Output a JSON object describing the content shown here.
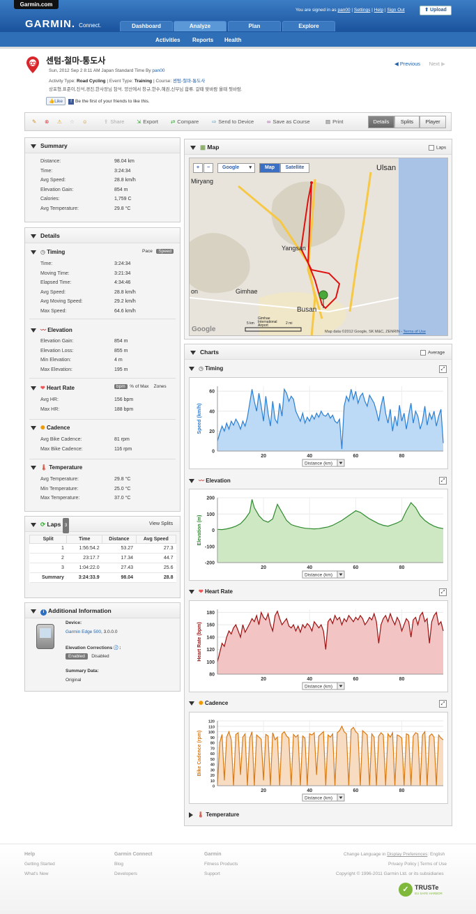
{
  "header": {
    "site": "Garmin.com",
    "logo": "GARMIN.",
    "logo_sub": "Connect.",
    "signed_in_prefix": "You are signed in as",
    "username": "pan00",
    "links": [
      "Settings",
      "Help",
      "Sign Out"
    ],
    "upload": "Upload",
    "tabs": [
      "Dashboard",
      "Analyze",
      "Plan",
      "Explore"
    ],
    "subnav": [
      "Activities",
      "Reports",
      "Health"
    ]
  },
  "activity": {
    "title": "센텀-철마-통도사",
    "date_line": "Sun, 2012 Sep 2 8:11 AM Japan Standard Time By",
    "author": "pan00",
    "type_label": "Activity Type:",
    "type": "Road Cycling",
    "event_label": "| Event Type:",
    "event": "Training",
    "course_label": "| Course:",
    "course": "센텀-철마-통도사",
    "description": "상포형,표준이,진석,경진,한사장님 참석. 양산에서 창규,한수,혜권,신부님 합류. 갈때 맞바람 올때 뒷바람.",
    "previous": "Previous",
    "next": "Next",
    "like": "Like",
    "like_text": "Be the first of your friends to like this."
  },
  "toolbar": {
    "items": [
      "Share",
      "Export",
      "Compare",
      "Send to Device",
      "Save as Course",
      "Print"
    ],
    "views": [
      "Details",
      "Splits",
      "Player"
    ]
  },
  "summary": {
    "title": "Summary",
    "rows": [
      {
        "label": "Distance:",
        "value": "98.04 km"
      },
      {
        "label": "Time:",
        "value": "3:24:34"
      },
      {
        "label": "Avg Speed:",
        "value": "28.8 km/h"
      },
      {
        "label": "Elevation Gain:",
        "value": "854 m"
      },
      {
        "label": "Calories:",
        "value": "1,759 C"
      },
      {
        "label": "Avg Temperature:",
        "value": "29.8 °C"
      }
    ]
  },
  "details": {
    "title": "Details",
    "timing": {
      "title": "Timing",
      "pace": "Pace",
      "speed": "Speed",
      "rows": [
        {
          "label": "Time:",
          "value": "3:24:34"
        },
        {
          "label": "Moving Time:",
          "value": "3:21:34"
        },
        {
          "label": "Elapsed Time:",
          "value": "4:34:46"
        },
        {
          "label": "Avg Speed:",
          "value": "28.8 km/h"
        },
        {
          "label": "Avg Moving Speed:",
          "value": "29.2 km/h"
        },
        {
          "label": "Max Speed:",
          "value": "64.6 km/h"
        }
      ]
    },
    "elevation": {
      "title": "Elevation",
      "rows": [
        {
          "label": "Elevation Gain:",
          "value": "854 m"
        },
        {
          "label": "Elevation Loss:",
          "value": "855 m"
        },
        {
          "label": "Min Elevation:",
          "value": "4 m"
        },
        {
          "label": "Max Elevation:",
          "value": "195 m"
        }
      ]
    },
    "heart": {
      "title": "Heart Rate",
      "bpm": "bpm",
      "pct": "% of Max",
      "zones": "Zones",
      "rows": [
        {
          "label": "Avg HR:",
          "value": "156 bpm"
        },
        {
          "label": "Max HR:",
          "value": "188 bpm"
        }
      ]
    },
    "cadence": {
      "title": "Cadence",
      "rows": [
        {
          "label": "Avg Bike Cadence:",
          "value": "81 rpm"
        },
        {
          "label": "Max Bike Cadence:",
          "value": "116 rpm"
        }
      ]
    },
    "temperature": {
      "title": "Temperature",
      "rows": [
        {
          "label": "Avg Temperature:",
          "value": "29.8 °C"
        },
        {
          "label": "Min Temperature:",
          "value": "25.0 °C"
        },
        {
          "label": "Max Temperature:",
          "value": "37.0 °C"
        }
      ]
    }
  },
  "laps": {
    "title": "Laps",
    "count": "3",
    "view_splits": "View Splits",
    "columns": [
      "Split",
      "Time",
      "Distance",
      "Avg Speed"
    ],
    "rows": [
      [
        "1",
        "1:56:54.2",
        "53.27",
        "27.3"
      ],
      [
        "2",
        "23:17.7",
        "17.34",
        "44.7"
      ],
      [
        "3",
        "1:04:22.0",
        "27.43",
        "25.6"
      ],
      [
        "Summary",
        "3:24:33.9",
        "98.04",
        "28.8"
      ]
    ]
  },
  "additional": {
    "title": "Additional Information",
    "device_label": "Device:",
    "device": "Garmin Edge 500",
    "device_version": ", 3.0.0.0",
    "corrections_label": "Elevation Corrections",
    "enabled": "Enabled",
    "disabled": "Disabled",
    "summary_label": "Summary Data:",
    "summary_value": "Original"
  },
  "map": {
    "title": "Map",
    "laps": "Laps",
    "provider": "Google",
    "map": "Map",
    "satellite": "Satellite",
    "labels": [
      "Ulsan",
      "Miryang",
      "Yangsan",
      "Gimhae",
      "Busan",
      "on",
      "Gimhae International Airport"
    ],
    "attribution": "Map data ©2012 Google, SK M&C, ZENRIN -",
    "terms": "Terms of Use",
    "google": "Google",
    "scale_km": "5 km",
    "scale_mi": "2 mi"
  },
  "charts": {
    "title": "Charts",
    "average": "Average",
    "xaxis": "Distance (km)",
    "temperature_title": "Temperature"
  },
  "chart_data": [
    {
      "type": "area",
      "title": "Timing",
      "ylabel": "Speed (km/h)",
      "xlabel": "Distance (km)",
      "ylim": [
        0,
        65
      ],
      "xlim": [
        0,
        98
      ],
      "yticks": [
        0,
        20,
        40,
        60
      ],
      "xticks": [
        20,
        40,
        60,
        80
      ],
      "color": "#2a7fd4",
      "fill": "#bcd9f5",
      "x": [
        0,
        1,
        2,
        3,
        4,
        5,
        6,
        7,
        8,
        9,
        10,
        11,
        12,
        13,
        14,
        15,
        16,
        17,
        18,
        19,
        20,
        21,
        22,
        23,
        24,
        25,
        26,
        27,
        28,
        29,
        30,
        31,
        32,
        33,
        34,
        35,
        36,
        37,
        38,
        39,
        40,
        41,
        42,
        43,
        44,
        45,
        46,
        47,
        48,
        49,
        50,
        51,
        52,
        53,
        54,
        55,
        56,
        57,
        58,
        59,
        60,
        61,
        62,
        63,
        64,
        65,
        66,
        67,
        68,
        69,
        70,
        71,
        72,
        73,
        74,
        75,
        76,
        77,
        78,
        79,
        80,
        81,
        82,
        83,
        84,
        85,
        86,
        87,
        88,
        89,
        90,
        91,
        92,
        93,
        94,
        95,
        96,
        97,
        98
      ],
      "y": [
        10,
        18,
        25,
        20,
        28,
        22,
        30,
        26,
        32,
        28,
        22,
        30,
        25,
        34,
        48,
        62,
        50,
        40,
        58,
        45,
        30,
        55,
        38,
        25,
        50,
        32,
        28,
        48,
        35,
        62,
        58,
        50,
        55,
        52,
        40,
        35,
        30,
        38,
        28,
        34,
        30,
        36,
        32,
        38,
        34,
        40,
        36,
        35,
        38,
        33,
        36,
        30,
        28,
        32,
        2,
        45,
        55,
        50,
        62,
        52,
        60,
        48,
        55,
        58,
        50,
        45,
        56,
        52,
        48,
        40,
        30,
        45,
        55,
        38,
        28,
        42,
        20,
        35,
        25,
        46,
        30,
        38,
        22,
        36,
        48,
        28,
        40,
        35,
        22,
        30,
        45,
        26,
        38,
        32,
        40,
        25,
        35,
        42,
        8
      ]
    },
    {
      "type": "area",
      "title": "Elevation",
      "ylabel": "Elevation (m)",
      "xlabel": "Distance (km)",
      "ylim": [
        -200,
        200
      ],
      "xlim": [
        0,
        98
      ],
      "yticks": [
        -200,
        -100,
        0,
        100,
        200
      ],
      "xticks": [
        20,
        40,
        60,
        80
      ],
      "color": "#2e8a2e",
      "fill": "#cfe8c4",
      "x": [
        0,
        2,
        4,
        6,
        8,
        10,
        12,
        14,
        15,
        16,
        18,
        20,
        22,
        24,
        26,
        28,
        30,
        32,
        34,
        36,
        38,
        40,
        42,
        44,
        46,
        48,
        50,
        52,
        54,
        56,
        58,
        60,
        62,
        64,
        66,
        68,
        70,
        72,
        74,
        76,
        78,
        80,
        82,
        84,
        86,
        88,
        90,
        92,
        94,
        96,
        98
      ],
      "y": [
        5,
        4,
        8,
        15,
        25,
        40,
        70,
        110,
        190,
        140,
        90,
        60,
        50,
        70,
        160,
        110,
        60,
        35,
        25,
        18,
        12,
        10,
        8,
        10,
        15,
        20,
        30,
        45,
        60,
        80,
        100,
        120,
        110,
        90,
        70,
        55,
        40,
        30,
        25,
        35,
        45,
        60,
        120,
        170,
        140,
        90,
        60,
        40,
        25,
        15,
        10
      ]
    },
    {
      "type": "area",
      "title": "Heart Rate",
      "ylabel": "Heart Rate (bpm)",
      "xlabel": "Distance (km)",
      "ylim": [
        80,
        185
      ],
      "xlim": [
        0,
        98
      ],
      "yticks": [
        80,
        100,
        120,
        140,
        160,
        180
      ],
      "xticks": [
        20,
        40,
        60,
        80
      ],
      "color": "#9b1010",
      "fill": "#f2c4c4",
      "x": [
        0,
        1,
        2,
        3,
        4,
        5,
        6,
        7,
        8,
        9,
        10,
        11,
        12,
        13,
        14,
        15,
        16,
        17,
        18,
        19,
        20,
        21,
        22,
        23,
        24,
        25,
        26,
        27,
        28,
        29,
        30,
        31,
        32,
        33,
        34,
        35,
        36,
        37,
        38,
        39,
        40,
        41,
        42,
        43,
        44,
        45,
        46,
        47,
        48,
        49,
        50,
        51,
        52,
        53,
        54,
        55,
        56,
        57,
        58,
        59,
        60,
        61,
        62,
        63,
        64,
        65,
        66,
        67,
        68,
        69,
        70,
        71,
        72,
        73,
        74,
        75,
        76,
        77,
        78,
        79,
        80,
        81,
        82,
        83,
        84,
        85,
        86,
        87,
        88,
        89,
        90,
        91,
        92,
        93,
        94,
        95,
        96,
        97,
        98
      ],
      "y": [
        100,
        115,
        130,
        125,
        140,
        150,
        145,
        155,
        160,
        150,
        140,
        160,
        148,
        155,
        162,
        170,
        165,
        175,
        160,
        180,
        172,
        168,
        178,
        160,
        150,
        175,
        182,
        170,
        160,
        165,
        170,
        158,
        155,
        160,
        150,
        158,
        148,
        160,
        155,
        162,
        158,
        150,
        165,
        160,
        155,
        160,
        150,
        120,
        165,
        170,
        162,
        175,
        168,
        172,
        160,
        170,
        165,
        175,
        170,
        165,
        172,
        168,
        175,
        170,
        160,
        165,
        172,
        168,
        178,
        165,
        130,
        160,
        170,
        175,
        165,
        178,
        168,
        160,
        172,
        165,
        150,
        160,
        170,
        165,
        140,
        168,
        172,
        160,
        175,
        180,
        165,
        170,
        130,
        165,
        175,
        180,
        160,
        165,
        150
      ]
    },
    {
      "type": "area",
      "title": "Cadence",
      "ylabel": "Bike Cadence (rpm)",
      "xlabel": "Distance (km)",
      "ylim": [
        0,
        120
      ],
      "xlim": [
        0,
        98
      ],
      "yticks": [
        0,
        10,
        20,
        30,
        40,
        50,
        60,
        70,
        80,
        90,
        100,
        110,
        120
      ],
      "xticks": [
        20,
        40,
        60,
        80
      ],
      "color": "#d97a14",
      "fill": "#f8dcc2",
      "x": [
        0,
        1,
        2,
        3,
        4,
        5,
        6,
        7,
        8,
        9,
        10,
        11,
        12,
        13,
        14,
        15,
        16,
        17,
        18,
        19,
        20,
        21,
        22,
        23,
        24,
        25,
        26,
        27,
        28,
        29,
        30,
        31,
        32,
        33,
        34,
        35,
        36,
        37,
        38,
        39,
        40,
        41,
        42,
        43,
        44,
        45,
        46,
        47,
        48,
        49,
        50,
        51,
        52,
        53,
        54,
        55,
        56,
        57,
        58,
        59,
        60,
        61,
        62,
        63,
        64,
        65,
        66,
        67,
        68,
        69,
        70,
        71,
        72,
        73,
        74,
        75,
        76,
        77,
        78,
        79,
        80,
        81,
        82,
        83,
        84,
        85,
        86,
        87,
        88,
        89,
        90,
        91,
        92,
        93,
        94,
        95,
        96,
        97,
        98
      ],
      "y": [
        0,
        80,
        95,
        10,
        90,
        100,
        85,
        0,
        95,
        98,
        20,
        90,
        96,
        0,
        88,
        100,
        0,
        94,
        90,
        86,
        10,
        95,
        92,
        0,
        98,
        85,
        90,
        0,
        96,
        100,
        92,
        88,
        0,
        95,
        90,
        94,
        0,
        92,
        88,
        0,
        96,
        94,
        98,
        20,
        92,
        96,
        100,
        0,
        94,
        90,
        96,
        0,
        98,
        102,
        110,
        100,
        96,
        0,
        104,
        108,
        100,
        96,
        0,
        102,
        98,
        94,
        0,
        96,
        90,
        0,
        92,
        98,
        94,
        0,
        96,
        90,
        98,
        0,
        94,
        92,
        88,
        0,
        96,
        94,
        0,
        92,
        98,
        96,
        0,
        94,
        100,
        0,
        92,
        96,
        90,
        0,
        94,
        88,
        85
      ]
    }
  ],
  "footer": {
    "help": "Help",
    "help_links": [
      "Getting Started",
      "What's New"
    ],
    "gc": "Garmin Connect",
    "gc_links": [
      "Blog",
      "Developers"
    ],
    "garmin": "Garmin",
    "garmin_links": [
      "Fitness Products",
      "Support"
    ],
    "lang_prefix": "Change Language in",
    "lang_link": "Display Preferences",
    "lang_suffix": ": English",
    "privacy": "Privacy Policy",
    "terms": "Terms of Use",
    "copyright": "Copyright © 1996-2011 Garmin Ltd. or its subsidiaries",
    "truste": "TRUSTe",
    "truste_sub": "EU SAFE HARBOR"
  }
}
